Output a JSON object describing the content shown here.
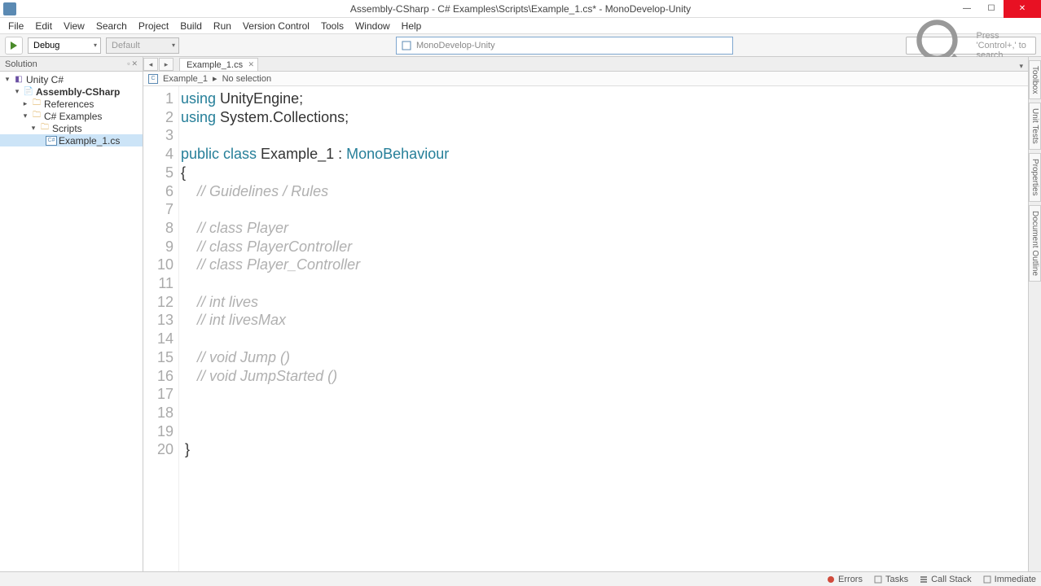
{
  "title": "Assembly-CSharp - C# Examples\\Scripts\\Example_1.cs* - MonoDevelop-Unity",
  "menu": [
    "File",
    "Edit",
    "View",
    "Search",
    "Project",
    "Build",
    "Run",
    "Version Control",
    "Tools",
    "Window",
    "Help"
  ],
  "toolbar": {
    "config": "Debug",
    "platform": "Default",
    "mid_search": "MonoDevelop-Unity",
    "right_search_placeholder": "Press 'Control+,' to search"
  },
  "solution": {
    "header": "Solution",
    "root": "Unity C#",
    "project": "Assembly-CSharp",
    "references": "References",
    "folder1": "C# Examples",
    "folder2": "Scripts",
    "file": "Example_1.cs"
  },
  "editor": {
    "tab": "Example_1.cs",
    "crumb1": "Example_1",
    "crumb_sep": "▸",
    "crumb2": "No selection"
  },
  "side_tabs": [
    "Toolbox",
    "Unit Tests",
    "Properties",
    "Document Outline"
  ],
  "code": {
    "lines": [
      {
        "n": 1,
        "segs": [
          {
            "t": "using ",
            "c": "kw"
          },
          {
            "t": "UnityEngine",
            "c": "cls"
          },
          {
            "t": ";",
            "c": "pun"
          }
        ]
      },
      {
        "n": 2,
        "segs": [
          {
            "t": "using ",
            "c": "kw"
          },
          {
            "t": "System.Collections",
            "c": "cls"
          },
          {
            "t": ";",
            "c": "pun"
          }
        ]
      },
      {
        "n": 3,
        "segs": [
          {
            "t": "",
            "c": ""
          }
        ]
      },
      {
        "n": 4,
        "segs": [
          {
            "t": "public class ",
            "c": "kw"
          },
          {
            "t": "Example_1",
            "c": "cls"
          },
          {
            "t": " : ",
            "c": "pun"
          },
          {
            "t": "MonoBehaviour",
            "c": "ty"
          }
        ]
      },
      {
        "n": 5,
        "segs": [
          {
            "t": "{",
            "c": "pun"
          }
        ]
      },
      {
        "n": 6,
        "segs": [
          {
            "t": "    ",
            "c": ""
          },
          {
            "t": "// Guidelines / Rules",
            "c": "com"
          }
        ]
      },
      {
        "n": 7,
        "segs": [
          {
            "t": "",
            "c": ""
          }
        ]
      },
      {
        "n": 8,
        "segs": [
          {
            "t": "    ",
            "c": ""
          },
          {
            "t": "// class Player",
            "c": "com"
          }
        ]
      },
      {
        "n": 9,
        "segs": [
          {
            "t": "    ",
            "c": ""
          },
          {
            "t": "// class PlayerController",
            "c": "com"
          }
        ]
      },
      {
        "n": 10,
        "segs": [
          {
            "t": "    ",
            "c": ""
          },
          {
            "t": "// class Player_Controller",
            "c": "com"
          }
        ]
      },
      {
        "n": 11,
        "segs": [
          {
            "t": "",
            "c": ""
          }
        ]
      },
      {
        "n": 12,
        "segs": [
          {
            "t": "    ",
            "c": ""
          },
          {
            "t": "// int lives",
            "c": "com"
          }
        ]
      },
      {
        "n": 13,
        "segs": [
          {
            "t": "    ",
            "c": ""
          },
          {
            "t": "// int livesMax",
            "c": "com"
          }
        ]
      },
      {
        "n": 14,
        "segs": [
          {
            "t": "",
            "c": ""
          }
        ]
      },
      {
        "n": 15,
        "segs": [
          {
            "t": "    ",
            "c": ""
          },
          {
            "t": "// void Jump ()",
            "c": "com"
          }
        ]
      },
      {
        "n": 16,
        "segs": [
          {
            "t": "    ",
            "c": ""
          },
          {
            "t": "// void JumpStarted ()",
            "c": "com"
          }
        ]
      },
      {
        "n": 17,
        "segs": [
          {
            "t": "",
            "c": ""
          }
        ]
      },
      {
        "n": 18,
        "segs": [
          {
            "t": "",
            "c": ""
          }
        ]
      },
      {
        "n": 19,
        "segs": [
          {
            "t": "",
            "c": ""
          }
        ]
      },
      {
        "n": 20,
        "segs": [
          {
            "t": " }",
            "c": "pun"
          }
        ]
      }
    ]
  },
  "status": {
    "errors": "Errors",
    "tasks": "Tasks",
    "callstack": "Call Stack",
    "immediate": "Immediate"
  }
}
